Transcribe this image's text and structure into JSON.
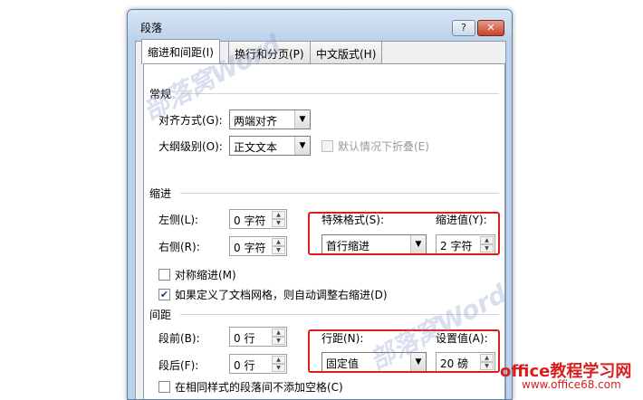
{
  "dialog": {
    "title": "段落",
    "help_label": "?",
    "close_label": "✕"
  },
  "tabs": [
    {
      "label": "缩进和间距(I)",
      "active": true
    },
    {
      "label": "换行和分页(P)",
      "active": false
    },
    {
      "label": "中文版式(H)",
      "active": false
    }
  ],
  "general": {
    "heading": "常规",
    "alignment_label": "对齐方式(G):",
    "alignment_value": "两端对齐",
    "outline_label": "大纲级别(O):",
    "outline_value": "正文文本",
    "collapse_label": "默认情况下折叠(E)"
  },
  "indent": {
    "heading": "缩进",
    "left_label": "左侧(L):",
    "left_value": "0 字符",
    "right_label": "右侧(R):",
    "right_value": "0 字符",
    "special_label": "特殊格式(S):",
    "special_value": "首行缩进",
    "by_label": "缩进值(Y):",
    "by_value": "2 字符",
    "mirror_label": "对称缩进(M)",
    "grid_label": "如果定义了文档网格，则自动调整右缩进(D)"
  },
  "spacing": {
    "heading": "间距",
    "before_label": "段前(B):",
    "before_value": "0 行",
    "after_label": "段后(F):",
    "after_value": "0 行",
    "line_label": "行距(N):",
    "line_value": "固定值",
    "at_label": "设置值(A):",
    "at_value": "20 磅",
    "same_style_label": "在相同样式的段落间不添加空格(C)"
  },
  "watermarks": {
    "top": "部落窝Word",
    "bottom": "部落窝Word"
  },
  "branding": {
    "name": "office教程学习网",
    "url": "www.office68.com"
  },
  "colors": {
    "highlight": "#e01b1b",
    "window_frame": "#bcd2ea"
  }
}
